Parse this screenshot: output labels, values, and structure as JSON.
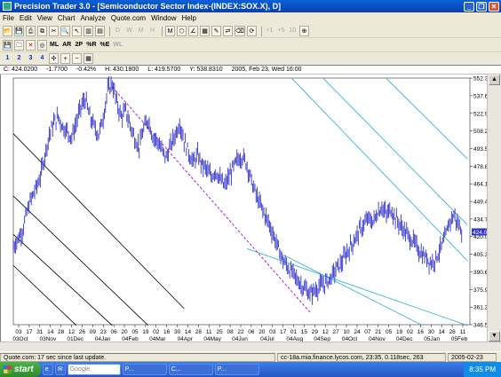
{
  "window": {
    "title": "Precision Trader 3.0 - [Semiconductor Sector Index-(INDEX:SOX.X), D]",
    "controls": [
      "_",
      "❐",
      "✕"
    ]
  },
  "menu": [
    "File",
    "Edit",
    "View",
    "Chart",
    "Analyze",
    "Quote.com",
    "Window",
    "Help"
  ],
  "toolbar1": {
    "periods": [
      "D",
      "W",
      "M",
      "H"
    ],
    "disabled_labels": [
      "+1",
      "+5",
      "10"
    ]
  },
  "toolbar2": {
    "labels": [
      "ML",
      "AR",
      "2P",
      "%R",
      "%E",
      "WL"
    ]
  },
  "toolbar3": {
    "numbers": [
      "1",
      "2",
      "3",
      "4"
    ]
  },
  "infobar": {
    "close": "C: 424.0200",
    "change": "-1.7700",
    "change_pct": "-0.42%",
    "high": "H: 430.1800",
    "low": "L: 419.5700",
    "y": "Y: 538.8310",
    "date": "2005, Feb 23, Wed 16:00"
  },
  "chart_data": {
    "type": "line",
    "subtype": "ohlc-bar",
    "symbol": "INDEX:SOX.X",
    "y_ticks": [
      "552.35190",
      "537.65216",
      "522.95631",
      "508.26193",
      "493.56558",
      "478.86924",
      "464.17289",
      "449.47654",
      "434.78020",
      "420.08286",
      "405.38551",
      "390.68865",
      "375.99230",
      "361.29562",
      "346.59880"
    ],
    "ylim": [
      346.6,
      552.4
    ],
    "last_price": "424.0200",
    "x_tick_days": [
      "03",
      "17",
      "31",
      "14",
      "28",
      "12",
      "26",
      "09",
      "23",
      "06",
      "20",
      "05",
      "19",
      "02",
      "16",
      "30",
      "14",
      "28",
      "11",
      "25",
      "08",
      "22",
      "06",
      "20",
      "03",
      "17",
      "01",
      "15",
      "29",
      "12",
      "27",
      "10",
      "24",
      "07",
      "21",
      "05",
      "19",
      "02",
      "16",
      "30",
      "14",
      "28",
      "11"
    ],
    "x_tick_months": [
      "03Oct",
      "03Nov",
      "01Dec",
      "04Jan",
      "04Feb",
      "04Mar",
      "04Apr",
      "04May",
      "04Jun",
      "04Jul",
      "04Aug",
      "04Sep",
      "04Oct",
      "04Nov",
      "04Dec",
      "05Jan",
      "05Feb"
    ],
    "series": [
      {
        "values": [
          412,
          418,
          425,
          440,
          452,
          460,
          470,
          488,
          505,
          515,
          520,
          512,
          508,
          503,
          515,
          528,
          535,
          520,
          512,
          505,
          520,
          542,
          548,
          532,
          520,
          525,
          513,
          502,
          495,
          510,
          518,
          504,
          500,
          492,
          486,
          496,
          505,
          515,
          500,
          490,
          482,
          488,
          480,
          476,
          470,
          475,
          468,
          462,
          470,
          478,
          485,
          487,
          480,
          466,
          455,
          446,
          438,
          430,
          420,
          410,
          400,
          395,
          390,
          385,
          380,
          376,
          372,
          375,
          378,
          380,
          383,
          388,
          394,
          398,
          405,
          412,
          418,
          425,
          430,
          435,
          432,
          440,
          445,
          438,
          443,
          436,
          430,
          425,
          420,
          416,
          410,
          405,
          402,
          398,
          402,
          410,
          418,
          432,
          438,
          430,
          424
        ]
      }
    ],
    "channels": {
      "dashed_purple": {
        "from": [
          22,
          545
        ],
        "to": [
          66,
          357
        ]
      },
      "black_lines": [
        {
          "from": [
            0,
            506
          ],
          "to": [
            38,
            360
          ]
        },
        {
          "from": [
            0,
            454
          ],
          "to": [
            30,
            346
          ]
        },
        {
          "from": [
            0,
            422
          ],
          "to": [
            22,
            346
          ]
        },
        {
          "from": [
            0,
            396
          ],
          "to": [
            14,
            346
          ]
        }
      ],
      "cyan_lines": [
        {
          "from": [
            62,
            552
          ],
          "to": [
            101,
            400
          ]
        },
        {
          "from": [
            69,
            552
          ],
          "to": [
            101,
            430
          ]
        },
        {
          "from": [
            83,
            552
          ],
          "to": [
            101,
            485
          ]
        },
        {
          "from": [
            52,
            410
          ],
          "to": [
            101,
            346
          ]
        },
        {
          "from": [
            60,
            405
          ],
          "to": [
            91,
            346
          ]
        }
      ]
    },
    "colors": {
      "bars": "#3333cc",
      "purple_channel": "#aa22cc",
      "cyan_channel": "#22aadd",
      "last_price_bg": "#3333cc"
    }
  },
  "status": {
    "quote": "Quote.com: 17 sec since last update.",
    "server": "cc-18a.mia.finance.lycos.com, 23:35, 0.118sec, 263",
    "date": "2005-02-23"
  },
  "taskbar": {
    "start": "start",
    "items": [
      "Google",
      "P...",
      "C...",
      "P..."
    ],
    "clock": "8:35 PM"
  }
}
